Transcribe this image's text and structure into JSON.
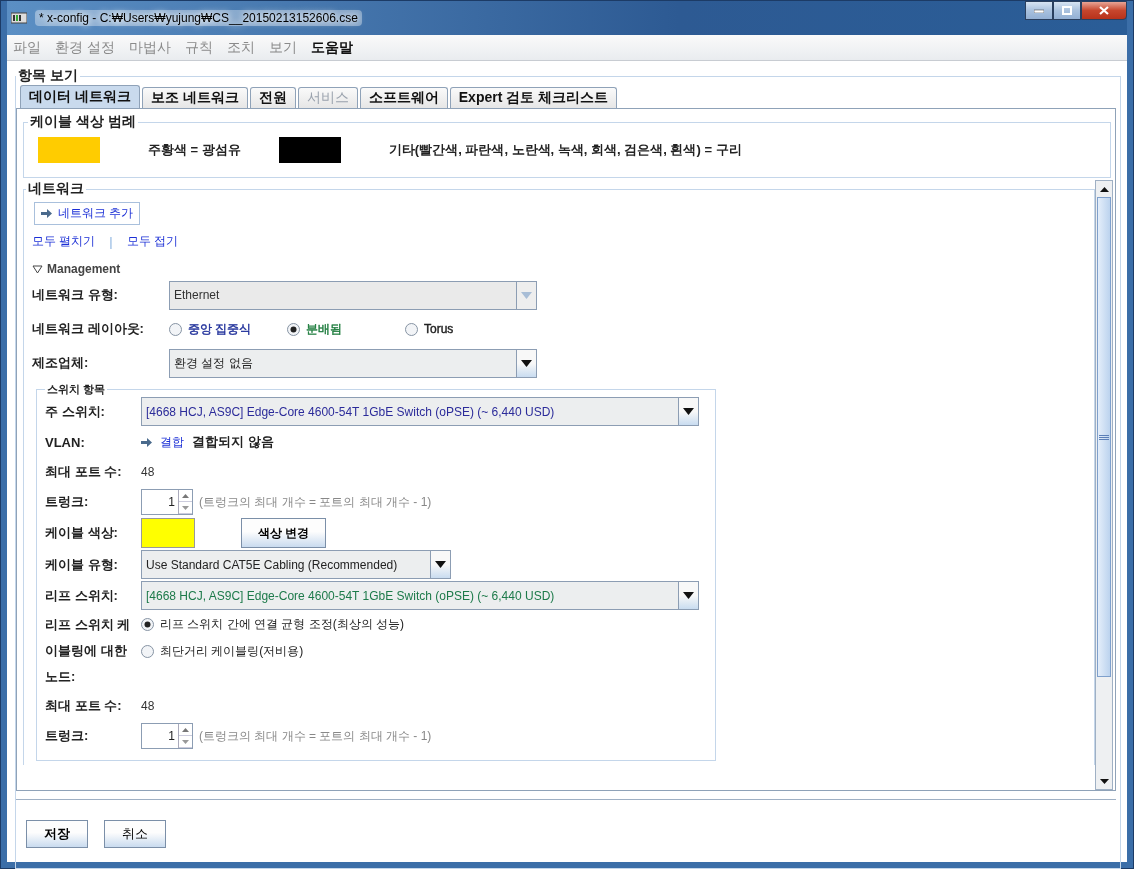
{
  "window": {
    "title": "* x-config - C:₩Users₩yujung₩CS__20150213152606.cse"
  },
  "menu": [
    {
      "label": "파일",
      "disabled": true
    },
    {
      "label": "환경 설정",
      "disabled": true
    },
    {
      "label": "마법사",
      "disabled": true
    },
    {
      "label": "규칙",
      "disabled": true
    },
    {
      "label": "조치",
      "disabled": true
    },
    {
      "label": "보기",
      "disabled": true
    },
    {
      "label": "도움말",
      "disabled": false
    }
  ],
  "view_group": {
    "title": "항목 보기"
  },
  "tabs": [
    {
      "label": "데이터 네트워크",
      "selected": true,
      "disabled": false
    },
    {
      "label": "보조 네트워크",
      "selected": false,
      "disabled": false
    },
    {
      "label": "전원",
      "selected": false,
      "disabled": false
    },
    {
      "label": "서비스",
      "selected": false,
      "disabled": true
    },
    {
      "label": "소프트웨어",
      "selected": false,
      "disabled": false
    },
    {
      "label": "Expert 검토 체크리스트",
      "selected": false,
      "disabled": false
    }
  ],
  "legend": {
    "title": "케이블 색상 범례",
    "items": [
      {
        "color": "#ffcc00",
        "label": "주황색 = 광섬유"
      },
      {
        "color": "#000000",
        "label": "기타(빨간색, 파란색, 노란색, 녹색, 회색, 검은색, 흰색) = 구리"
      }
    ]
  },
  "network": {
    "title": "네트워크",
    "add_button": "네트워크 추가",
    "expand_all": "모두 펼치기",
    "separator": "|",
    "collapse_all": "모두 접기",
    "management": {
      "title": "Management",
      "expanded": true,
      "network_type": {
        "label": "네트워크 유형:",
        "value": "Ethernet",
        "disabled": true
      },
      "layout": {
        "label": "네트워크 레이아웃:",
        "options": [
          {
            "label": "중앙 집중식",
            "selected": false,
            "color": "#1f2f9a"
          },
          {
            "label": "분배됨",
            "selected": true,
            "color": "#1a7a3a"
          },
          {
            "label": "Torus",
            "selected": false,
            "color": "#222222"
          }
        ]
      },
      "manufacturer": {
        "label": "제조업체:",
        "value": "환경 설정 없음",
        "disabled": false
      },
      "switch_group": {
        "title": "스위치 항목",
        "rows": [
          {
            "kind": "select",
            "label": "주 스위치:",
            "value": "[4668 HCJ, AS9C] Edge-Core 4600-54T 1GbE Switch (oPSE) (~ 6,440 USD)",
            "color": "#2b2b9a"
          },
          {
            "kind": "vlan",
            "label": "VLAN:",
            "link": "결합",
            "text": "결합되지 않음"
          },
          {
            "kind": "text",
            "label": "최대 포트 수:",
            "value": "48"
          },
          {
            "kind": "spinner",
            "label": "트렁크:",
            "value": "1",
            "hint": "(트렁크의 최대 개수 = 포트의 최대 개수 - 1)"
          },
          {
            "kind": "color",
            "label": "케이블 색상:",
            "color": "#ffff00",
            "button": "색상 변경"
          },
          {
            "kind": "short_select",
            "label": "케이블 유형:",
            "value": "Use Standard CAT5E Cabling (Recommended)",
            "color": "#222222"
          },
          {
            "kind": "select",
            "label": "리프 스위치:",
            "value": "[4668 HCJ, AS9C] Edge-Core 4600-54T 1GbE Switch (oPSE) (~ 6,440 USD)",
            "color": "#1d7a4a"
          },
          {
            "kind": "radios",
            "label": "리프 스위치 케이블링에 대한 노드:",
            "options": [
              {
                "label": "리프 스위치 간에 연결 균형 조정(최상의 성능)",
                "selected": true
              },
              {
                "label": "최단거리 케이블링(저비용)",
                "selected": false
              }
            ]
          },
          {
            "kind": "text",
            "label": "최대 포트 수:",
            "value": "48"
          },
          {
            "kind": "spinner",
            "label": "트렁크:",
            "value": "1",
            "hint": "(트렁크의 최대 개수 = 포트의 최대 개수 - 1)"
          }
        ]
      }
    }
  },
  "buttons": [
    {
      "label": "저장"
    },
    {
      "label": "취소"
    }
  ]
}
